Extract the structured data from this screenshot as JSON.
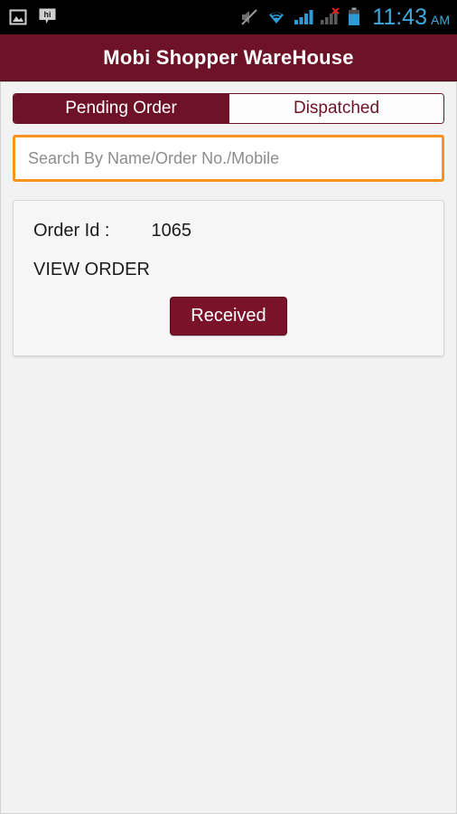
{
  "statusbar": {
    "left_icons": [
      {
        "name": "gallery-image-icon",
        "glyph": "image"
      },
      {
        "name": "hike-message-icon",
        "glyph": "hi"
      }
    ],
    "right_icons": [
      {
        "name": "volume-muted-icon"
      },
      {
        "name": "wifi-icon"
      },
      {
        "name": "cellular-signal-icon"
      },
      {
        "name": "cellular-signal-no-service-icon"
      },
      {
        "name": "battery-icon"
      }
    ],
    "time": "11:43",
    "meridiem": "AM",
    "time_color": "#3fa9dd",
    "background": "#000000"
  },
  "header": {
    "title": "Mobi Shopper WareHouse",
    "background": "#6e1327",
    "text_color": "#ffffff"
  },
  "tabs": [
    {
      "label": "Pending Order",
      "active": true
    },
    {
      "label": "Dispatched",
      "active": false
    }
  ],
  "search": {
    "value": "",
    "placeholder": "Search By Name/Order No./Mobile",
    "border_color": "#f79421"
  },
  "orders": [
    {
      "id_label": "Order Id :",
      "id_value": "1065",
      "view_order_label": "VIEW ORDER",
      "action_label": "Received",
      "action_color": "#7a1229"
    }
  ]
}
